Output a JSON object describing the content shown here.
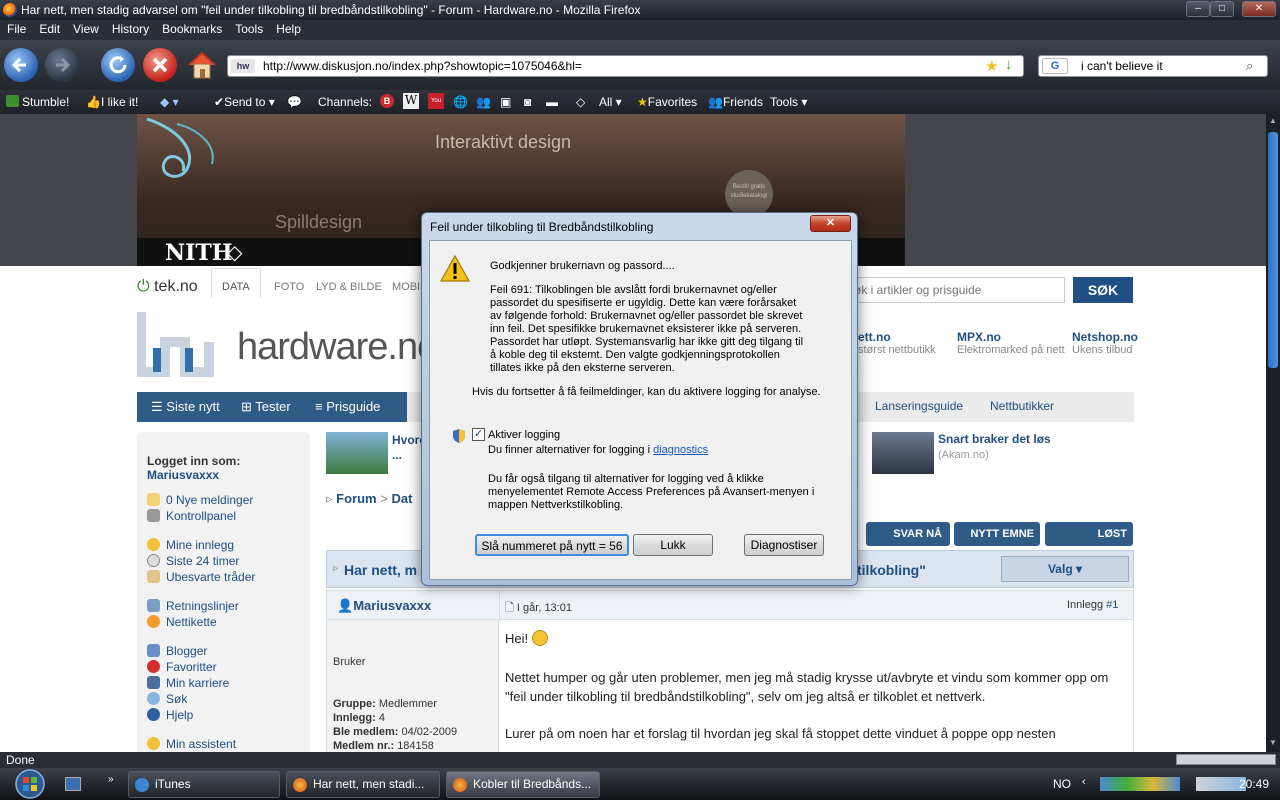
{
  "window": {
    "title": "Har nett, men stadig advarsel om \"feil under tilkobling til bredbåndstilkobling\" - Forum - Hardware.no - Mozilla Firefox",
    "min": "‒",
    "max": "□",
    "close": "✕"
  },
  "menu": [
    "File",
    "Edit",
    "View",
    "History",
    "Bookmarks",
    "Tools",
    "Help"
  ],
  "nav": {
    "url": "http://www.diskusjon.no/index.php?showtopic=1075046&hl=",
    "site_badge": "hw",
    "search_query": "i can't believe it",
    "search_engine": "G"
  },
  "bookmarks": {
    "stumble": "Stumble!",
    "ilike": "I like it!",
    "sendto": "Send to",
    "channels": "Channels:",
    "all": "All",
    "favorites": "Favorites",
    "friends": "Friends",
    "tools": "Tools"
  },
  "banner": {
    "t1": "Interaktivt design",
    "t2": "Spilldesign",
    "seal": "Bestill gratis studiekatalog!",
    "brand": "NITH"
  },
  "tek": {
    "logo": "tek.no",
    "tabs": [
      "DATA",
      "FOTO",
      "LYD & BILDE",
      "MOBIL"
    ],
    "search_placeholder": "Søk i artikler og prisguide",
    "search_btn": "SØK"
  },
  "hardware_logo": "hardware.no",
  "partners": [
    {
      "name": "Komplett.no",
      "sub": "Norges største nettbutikk"
    },
    {
      "name": "MPX.no",
      "sub": "Elektromarked på nett"
    },
    {
      "name": "Netshop.no",
      "sub": "Ukens tilbud"
    }
  ],
  "site_nav": {
    "left": [
      "Siste nytt",
      "Tester",
      "Prisguide"
    ],
    "right": [
      "Lanseringsguide",
      "Nettbutikker"
    ]
  },
  "sidebar": {
    "logged_in_label": "Logget inn som:",
    "username": "Mariusvaxxx",
    "links": [
      "0 Nye meldinger",
      "Kontrollpanel",
      "Mine innlegg",
      "Siste 24 timer",
      "Ubesvarte tråder",
      "Retningslinjer",
      "Nettikette",
      "Blogger",
      "Favoritter",
      "Min karriere",
      "Søk",
      "Hjelp",
      "Min assistent"
    ]
  },
  "main": {
    "promo_left": "Hvordan ... video",
    "promo_right_title": "Snart braker det løs",
    "promo_right_src": "(Akam.no)",
    "breadcrumb_forum": "Forum",
    "breadcrumb_sep": ">",
    "breadcrumb_rest": "Dat",
    "buttons": [
      "SVAR NÅ",
      "NYTT EMNE",
      "LØST"
    ],
    "thread_title_left": "Har nett, m",
    "thread_title_right": "tilkobling\"",
    "valg": "Valg ▾",
    "author": "Mariusvaxxx",
    "post_time": "I går, 13:01",
    "post_label": "Innlegg",
    "post_num": "#1",
    "role": "Bruker",
    "group_label": "Gruppe:",
    "group_value": "Medlemmer",
    "posts_label": "Innlegg:",
    "posts_value": "4",
    "member_label": "Ble medlem:",
    "member_value": "04/02-2009",
    "memberno_label": "Medlem nr.:",
    "memberno_value": "184158",
    "greeting": "Hei!",
    "para1": "Nettet humper og går uten problemer, men jeg må stadig krysse ut/avbryte et vindu som kommer opp om \"feil under tilkobling til bredbåndstilkobling\", selv om jeg altså er tilkoblet et nettverk.",
    "para2": "Lurer på om noen har et forslag til hvordan jeg skal få stoppet dette vinduet å poppe opp nesten"
  },
  "dialog": {
    "title": "Feil under tilkobling til Bredbåndstilkobling",
    "status": "Godkjenner brukernavn og passord....",
    "error": "Feil 691: Tilkoblingen ble avslått fordi brukernavnet og/eller passordet du spesifiserte er ugyldig. Dette kan være forårsaket av følgende forhold: Brukernavnet og/eller passordet ble skrevet inn feil. Det spesifikke brukernavnet eksisterer ikke på serveren. Passordet har utløpt. Systemansvarlig har ikke gitt deg tilgang til å koble deg til ekstemt. Den valgte godkjenningsprotokollen tillates ikke på den eksterne serveren.",
    "hint": "Hvis du fortsetter å få feilmeldinger, kan du aktivere logging for analyse.",
    "checkbox_label": "Aktiver logging",
    "logging_text": "Du finner alternativer for logging i",
    "logging_link": "diagnostics",
    "more_text": "Du får også tilgang til alternativer for logging ved å klikke menyelementet Remote Access Preferences på Avansert-menyen i mappen Nettverkstilkobling.",
    "redial": "Slå nummeret på nytt = 56",
    "close": "Lukk",
    "diagnose": "Diagnostiser"
  },
  "status": "Done",
  "taskbar": {
    "items": [
      "iTunes",
      "Har nett, men stadi...",
      "Kobler til Bredbånds..."
    ],
    "lang": "NO",
    "time": "20:49"
  }
}
